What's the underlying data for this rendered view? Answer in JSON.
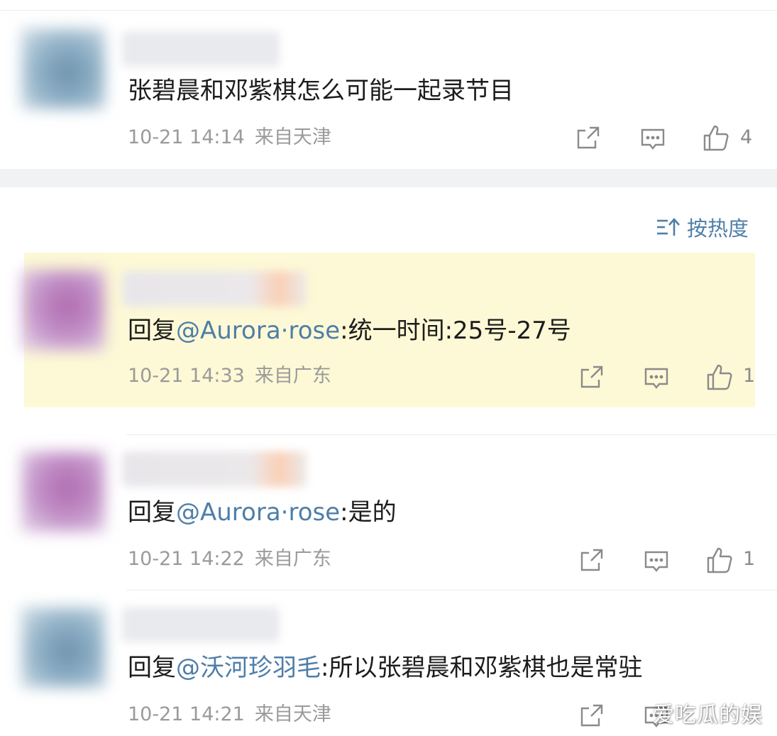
{
  "comments": [
    {
      "text_plain": "张碧晨和邓紫棋怎么可能一起录节目",
      "date": "10-21 14:14",
      "location": "来自天津",
      "likes": "4"
    },
    {
      "reply_prefix": "回复",
      "mention": "@Aurora·rose",
      "text": ":统一时间:25号-27号",
      "date": "10-21 14:33",
      "location": "来自广东",
      "likes": "1"
    },
    {
      "reply_prefix": "回复",
      "mention": "@Aurora·rose",
      "text": ":是的",
      "date": "10-21 14:22",
      "location": "来自广东",
      "likes": "1"
    },
    {
      "reply_prefix": "回复",
      "mention": "@沃河珍羽毛",
      "text": ":所以张碧晨和邓紫棋也是常驻",
      "date": "10-21 14:21",
      "location": "来自天津"
    }
  ],
  "sort": {
    "label": "按热度",
    "icon": "sort-icon"
  },
  "watermark": "爱吃瓜的娱",
  "colors": {
    "mention": "#4e7ea8",
    "highlight": "#fdf9d6",
    "meta": "#9a9a9a"
  }
}
